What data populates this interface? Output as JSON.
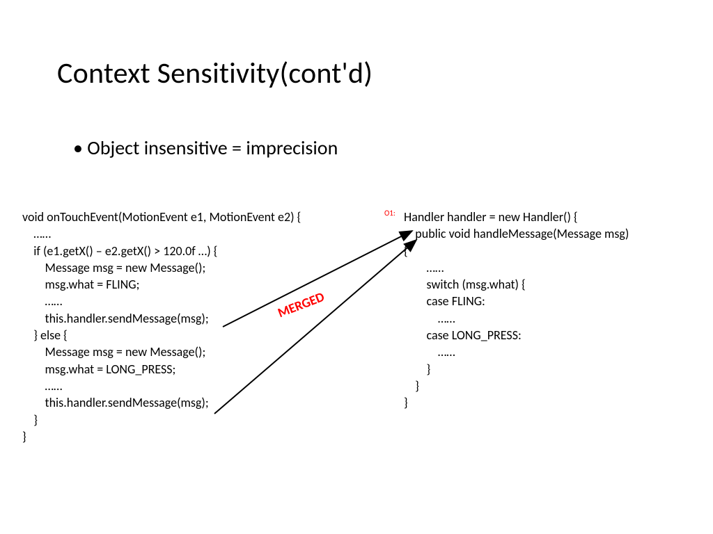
{
  "title": "Context Sensitivity(cont'd)",
  "bullet": "Object insensitive  = imprecision",
  "code_left": "void onTouchEvent(MotionEvent e1, MotionEvent e2) {\n    ……\n    if (e1.getX() – e2.getX() > 120.0f …) {\n        Message msg = new Message();\n        msg.what = FLING;\n        ……\n        this.handler.sendMessage(msg);\n    } else {\n        Message msg = new Message();\n        msg.what = LONG_PRESS;\n        ……\n        this.handler.sendMessage(msg);\n    }\n}",
  "o1_label": "O1:",
  "code_right": "Handler handler = new Handler() {\n    public void handleMessage(Message msg) \n{\n        ……\n        switch (msg.what) {\n        case FLING:\n            ……\n        case LONG_PRESS:\n            ……\n        }\n    }\n}",
  "merged_label": "MERGED"
}
